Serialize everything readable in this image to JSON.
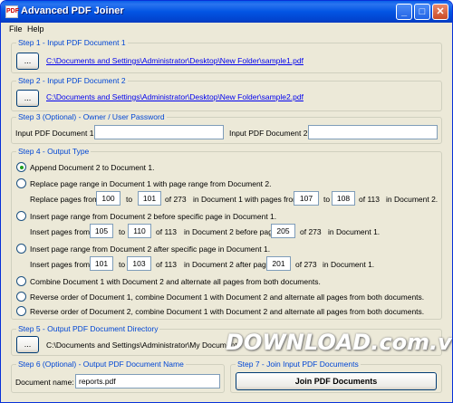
{
  "window": {
    "title": "Advanced PDF Joiner",
    "icon_label": "PDF"
  },
  "titlebar_buttons": [
    "_",
    "□",
    "✕"
  ],
  "menu": [
    "File",
    "Help"
  ],
  "step1": {
    "label": "Step 1 - Input PDF Document 1",
    "browse": "...",
    "path": "C:\\Documents and Settings\\Administrator\\Desktop\\New Folder\\sample1.pdf"
  },
  "step2": {
    "label": "Step 2 - Input PDF Document 2",
    "browse": "...",
    "path": "C:\\Documents and Settings\\Administrator\\Desktop\\New Folder\\sample2.pdf"
  },
  "step3": {
    "label": "Step 3 (Optional) - Owner / User Password",
    "pw1_label": "Input PDF Document 1:",
    "pw1_value": "",
    "pw2_label": "Input PDF Document 2:",
    "pw2_value": ""
  },
  "step4": {
    "label": "Step 4 - Output Type",
    "selected": 0,
    "opt1": "Append Document 2 to Document 1.",
    "opt2": "Replace page range in Document 1 with page range from Document 2.",
    "opt2_row": {
      "prefix": "Replace pages from",
      "from": "100",
      "to_label": "to",
      "to": "101",
      "of1": "of 273",
      "mid": "in Document 1 with pages from",
      "from2": "107",
      "to2_label": "to",
      "to2": "108",
      "of2": "of 113",
      "suffix": "in Document 2."
    },
    "opt3": "Insert page range from Document 2 before specific page in Document 1.",
    "opt3_row": {
      "prefix": "Insert pages from",
      "from": "105",
      "to_label": "to",
      "to": "110",
      "of1": "of 113",
      "mid": "in Document 2 before page",
      "page": "205",
      "of2": "of 273",
      "suffix": "in Document 1."
    },
    "opt4": "Insert page range from Document 2 after specific page in Document 1.",
    "opt4_row": {
      "prefix": "Insert pages from",
      "from": "101",
      "to_label": "to",
      "to": "103",
      "of1": "of 113",
      "mid": "in Document 2 after page",
      "page": "201",
      "of2": "of 273",
      "suffix": "in Document 1."
    },
    "opt5": "Combine Document 1 with Document 2 and alternate all pages from both documents.",
    "opt6": "Reverse order of Document 1, combine Document 1 with Document 2 and alternate all pages from both documents.",
    "opt7": "Reverse order of Document 2, combine Document 1 with Document 2 and alternate all pages from both documents."
  },
  "step5": {
    "label": "Step 5 - Output PDF Document Directory",
    "browse": "...",
    "path": "C:\\Documents and Settings\\Administrator\\My Documents"
  },
  "step6": {
    "label": "Step 6 (Optional) - Output PDF Document Name",
    "name_label": "Document name:",
    "name_value": "reports.pdf"
  },
  "step7": {
    "label": "Step 7 - Join Input PDF Documents",
    "button": "Join PDF Documents"
  },
  "watermark": "DOWNLOAD.com.vn"
}
